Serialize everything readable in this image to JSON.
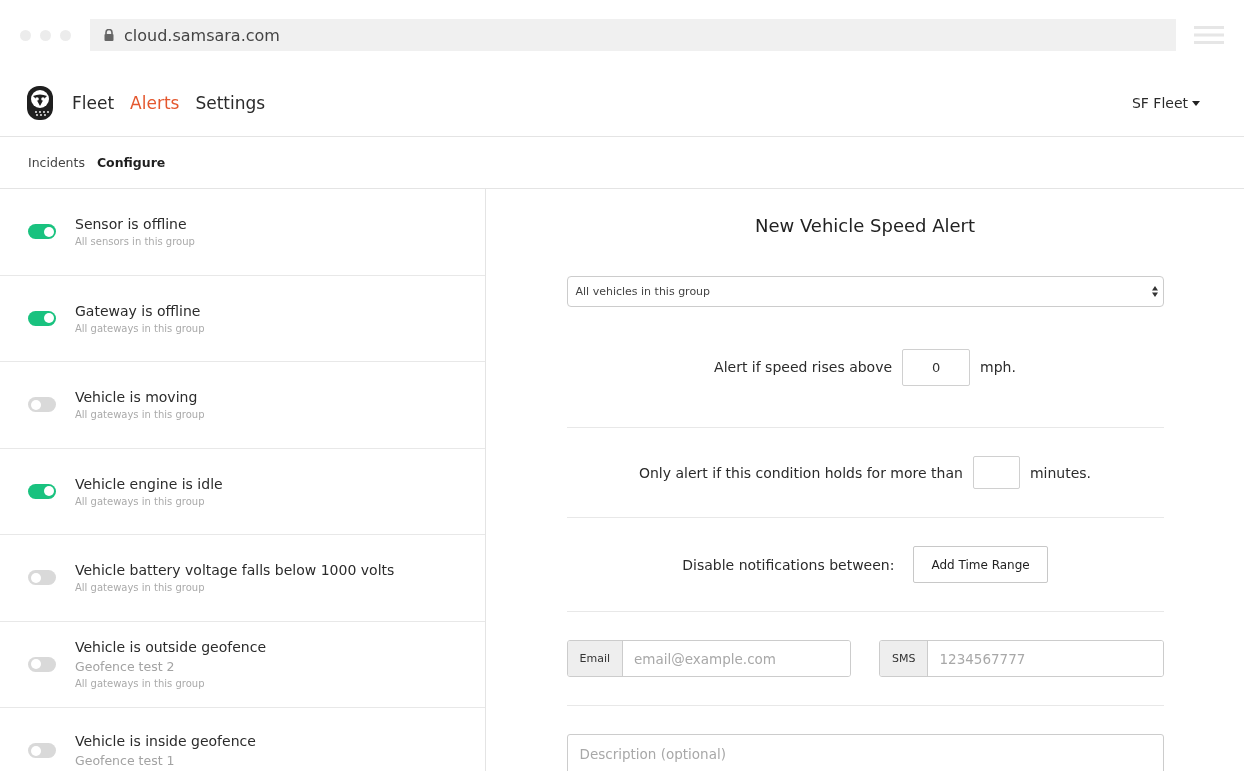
{
  "browser": {
    "url": "cloud.samsara.com"
  },
  "nav": {
    "items": [
      {
        "label": "Fleet",
        "selected": false
      },
      {
        "label": "Alerts",
        "selected": true
      },
      {
        "label": "Settings",
        "selected": false
      }
    ],
    "fleet_menu": "SF Fleet"
  },
  "subtabs": [
    {
      "label": "Incidents",
      "selected": false
    },
    {
      "label": "Configure",
      "selected": true
    }
  ],
  "alerts": [
    {
      "title": "Sensor is offline",
      "on": true,
      "details": [
        "All sensors in this group"
      ]
    },
    {
      "title": "Gateway is offline",
      "on": true,
      "details": [
        "All gateways in this group"
      ]
    },
    {
      "title": "Vehicle is moving",
      "on": false,
      "details": [
        "All gateways in this group"
      ]
    },
    {
      "title": "Vehicle engine is idle",
      "on": true,
      "details": [
        "All gateways in this group"
      ]
    },
    {
      "title": "Vehicle battery voltage falls below 1000 volts",
      "on": false,
      "details": [
        "All gateways in this group"
      ]
    },
    {
      "title": "Vehicle is outside geofence",
      "on": false,
      "geofence": "Geofence test 2",
      "details": [
        "All gateways in this group"
      ]
    },
    {
      "title": "Vehicle is inside geofence",
      "on": false,
      "geofence": "Geofence test 1"
    }
  ],
  "form": {
    "title": "New Vehicle Speed Alert",
    "scope_select": "All vehicles in this group",
    "speed": {
      "label": "Alert if speed rises above",
      "value": "0",
      "unit": "mph."
    },
    "duration": {
      "label": "Only alert if this condition holds for more than",
      "unit": "minutes."
    },
    "quiet_hours": {
      "label": "Disable notifications between:",
      "button": "Add Time Range"
    },
    "contacts": [
      {
        "addon": "Email",
        "placeholder": "email@example.com"
      },
      {
        "addon": "SMS",
        "placeholder": "1234567777"
      }
    ],
    "description": {
      "placeholder": "Description (optional)"
    }
  }
}
